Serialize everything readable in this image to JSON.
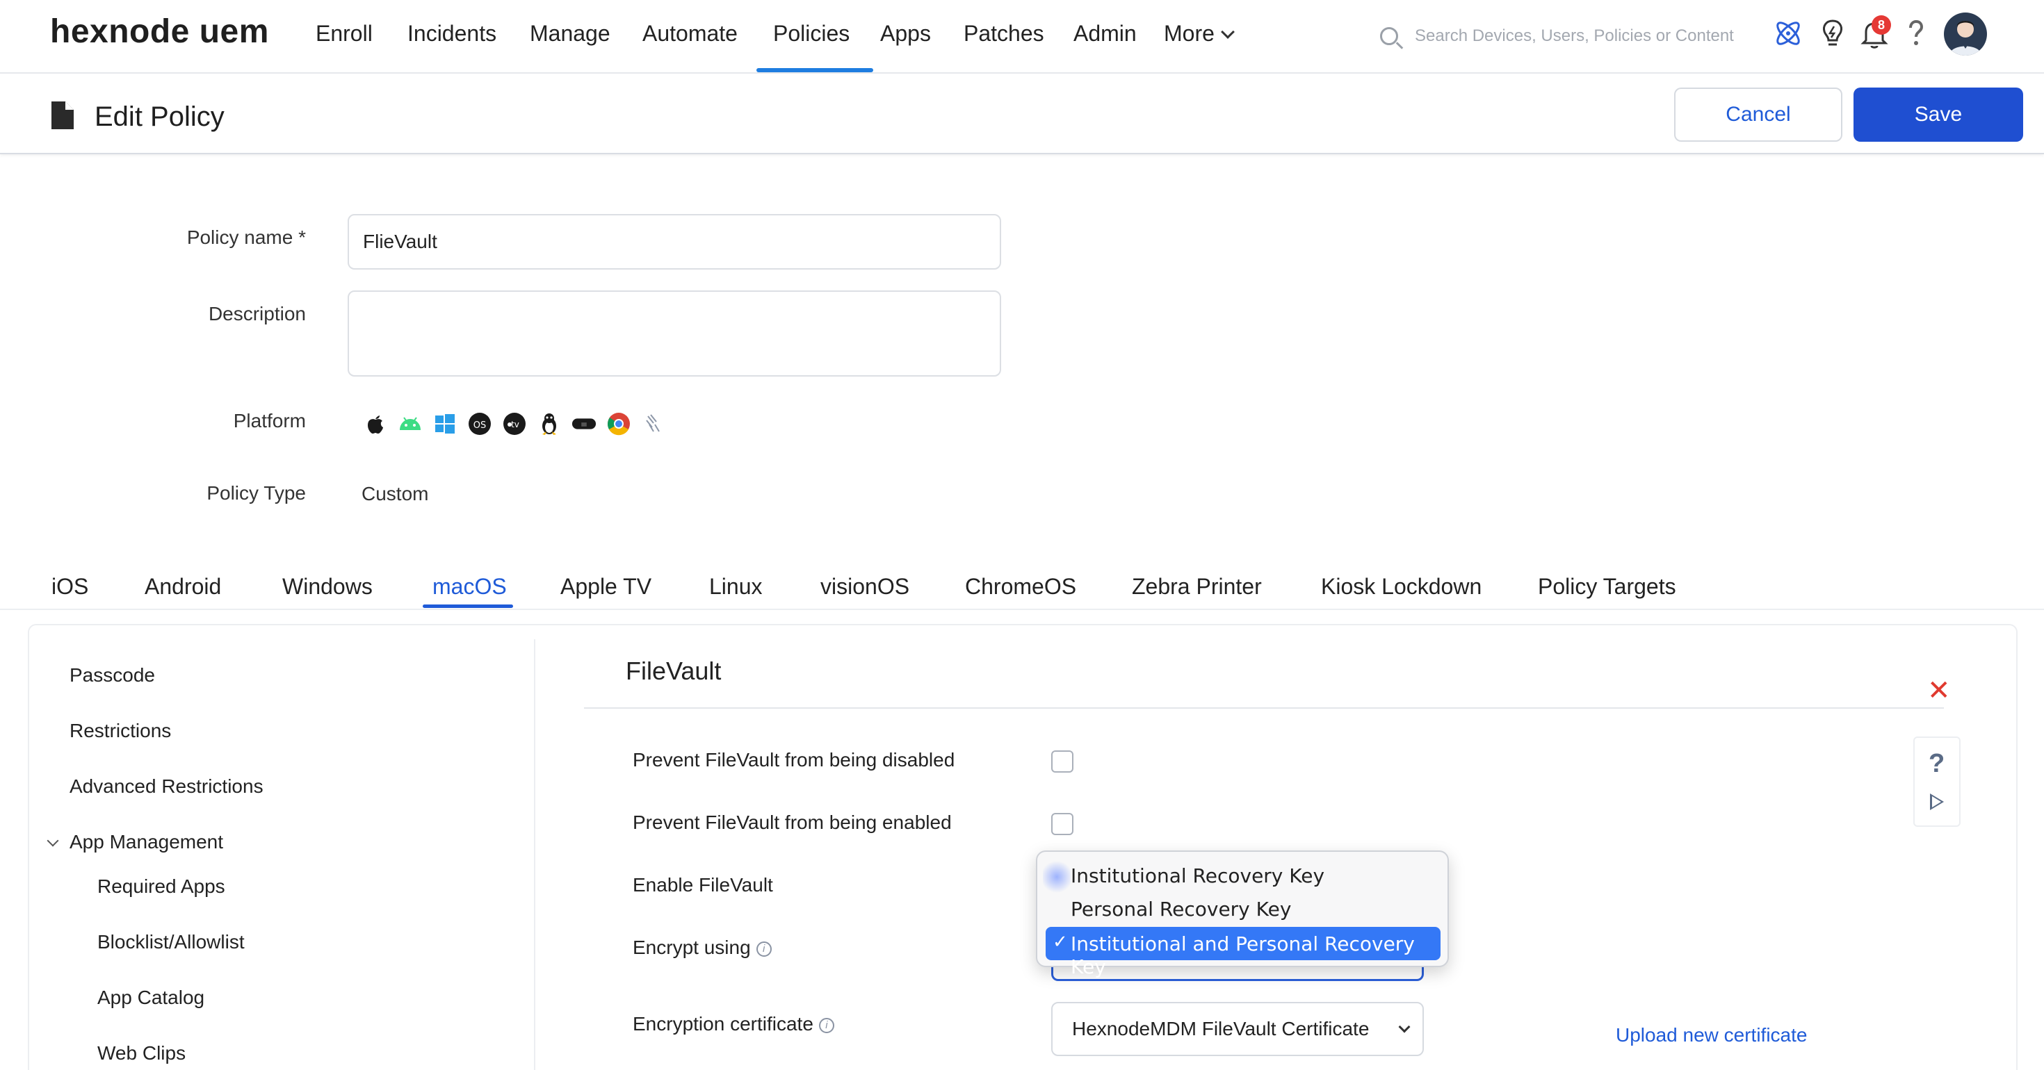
{
  "app": {
    "logo": "hexnode uem"
  },
  "nav": {
    "items": [
      "Enroll",
      "Incidents",
      "Manage",
      "Automate",
      "Policies",
      "Apps",
      "Patches",
      "Admin"
    ],
    "more_label": "More",
    "active": "Policies",
    "search_placeholder": "Search Devices, Users, Policies or Content",
    "notification_count": "8"
  },
  "page": {
    "title": "Edit Policy",
    "cancel_label": "Cancel",
    "save_label": "Save"
  },
  "form": {
    "policy_name_label": "Policy name *",
    "policy_name_value": "FlieVault",
    "description_label": "Description",
    "description_value": "",
    "platform_label": "Platform",
    "policy_type_label": "Policy Type",
    "policy_type_value": "Custom"
  },
  "platform_icons": [
    "apple-icon",
    "android-icon",
    "windows-icon",
    "tvos-icon",
    "apple-tv-icon",
    "linux-icon",
    "visionos-icon",
    "chrome-icon",
    "zebra-icon"
  ],
  "tabs": {
    "items": [
      "iOS",
      "Android",
      "Windows",
      "macOS",
      "Apple TV",
      "Linux",
      "visionOS",
      "ChromeOS",
      "Zebra Printer",
      "Kiosk Lockdown",
      "Policy Targets"
    ],
    "active": "macOS"
  },
  "sidebar": {
    "items": [
      "Passcode",
      "Restrictions",
      "Advanced Restrictions"
    ],
    "group": {
      "label": "App Management",
      "items": [
        "Required Apps",
        "Blocklist/Allowlist",
        "App Catalog",
        "Web Clips"
      ]
    }
  },
  "section": {
    "title": "FileVault",
    "rows": {
      "prevent_disable": "Prevent FileVault from being disabled",
      "prevent_enable": "Prevent FileVault from being enabled",
      "enable": "Enable FileVault",
      "encrypt_using": "Encrypt using",
      "encryption_certificate": "Encryption certificate"
    },
    "certificate_value": "HexnodeMDM FileVault Certificate",
    "upload_link": "Upload new certificate"
  },
  "dropdown": {
    "options": [
      "Institutional Recovery Key",
      "Personal Recovery Key",
      "Institutional and Personal Recovery Key"
    ],
    "selected": "Institutional and Personal Recovery Key",
    "check_mark": "✓"
  },
  "colors": {
    "accent": "#1f5bd8",
    "save_button": "#1f4fd1",
    "close": "#e03a2f",
    "dropdown_selected": "#3478f6",
    "badge": "#e53935"
  }
}
